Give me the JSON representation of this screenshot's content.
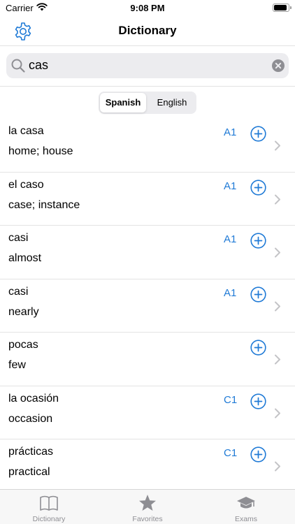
{
  "status_bar": {
    "carrier": "Carrier",
    "time": "9:08 PM",
    "battery_level": 0.9
  },
  "nav": {
    "title": "Dictionary",
    "settings_icon": "gear-icon"
  },
  "search": {
    "query": "cas",
    "search_icon": "search-icon",
    "clear_icon": "clear-icon"
  },
  "language_toggle": {
    "options": [
      "Spanish",
      "English"
    ],
    "selected": "Spanish"
  },
  "entries": [
    {
      "word": "la casa",
      "translation": "home; house",
      "level": "A1"
    },
    {
      "word": "el caso",
      "translation": "case; instance",
      "level": "A1"
    },
    {
      "word": "casi",
      "translation": "almost",
      "level": "A1"
    },
    {
      "word": "casi",
      "translation": "nearly",
      "level": "A1"
    },
    {
      "word": "pocas",
      "translation": "few",
      "level": ""
    },
    {
      "word": "la ocasión",
      "translation": "occasion",
      "level": "C1"
    },
    {
      "word": "prácticas",
      "translation": "practical",
      "level": "C1"
    }
  ],
  "tab_bar": {
    "tabs": [
      {
        "label": "Dictionary",
        "icon": "book-icon"
      },
      {
        "label": "Favorites",
        "icon": "star-icon"
      },
      {
        "label": "Exams",
        "icon": "graduation-cap-icon"
      }
    ]
  },
  "colors": {
    "accent": "#1f7ad6",
    "separator": "#e3e3e3",
    "tab_gray": "#8e8e93"
  }
}
